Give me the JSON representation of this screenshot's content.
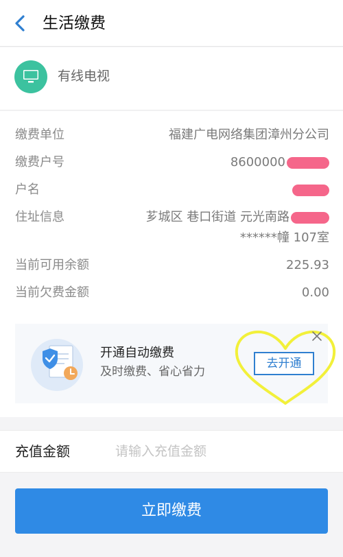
{
  "header": {
    "title": "生活缴费"
  },
  "service": {
    "name": "有线电视",
    "icon": "tv-icon"
  },
  "details": {
    "rows": [
      {
        "label": "缴费单位",
        "value": "福建广电网络集团漳州分公司"
      },
      {
        "label": "缴费户号",
        "value": "8600000"
      },
      {
        "label": "户名",
        "value": ""
      },
      {
        "label": "住址信息",
        "value": "芗城区 巷口街道 元光南路",
        "value_line2": "******幢 107室"
      },
      {
        "label": "当前可用余额",
        "value": "225.93"
      },
      {
        "label": "当前欠费金额",
        "value": "0.00"
      }
    ]
  },
  "promo": {
    "title": "开通自动缴费",
    "subtitle": "及时缴费、省心省力",
    "button": "去开通",
    "highlight_color": "#f2f03a"
  },
  "amount": {
    "label": "充值金额",
    "placeholder": "请输入充值金额"
  },
  "pay_button": {
    "label": "立即缴费"
  },
  "colors": {
    "accent": "#2f8ae5",
    "service_icon_bg": "#3cc29f",
    "redaction": "#f5668a"
  }
}
